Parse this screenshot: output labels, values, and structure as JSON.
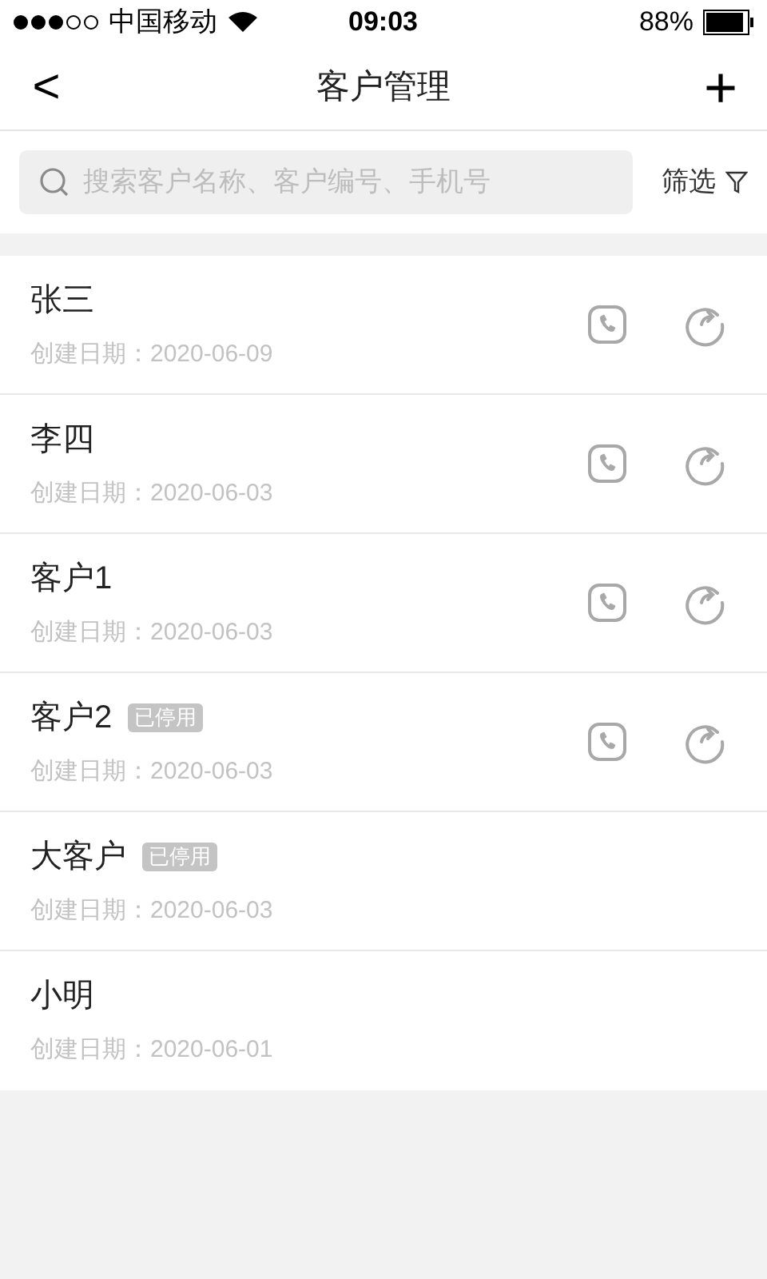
{
  "status_bar": {
    "carrier": "中国移动",
    "time": "09:03",
    "battery": "88%"
  },
  "nav": {
    "back": "<",
    "title": "客户管理",
    "add": "+"
  },
  "search": {
    "placeholder": "搜索客户名称、客户编号、手机号",
    "filter": "筛选"
  },
  "customers": [
    {
      "name": "张三",
      "date": "创建日期：2020-06-09",
      "actions": true
    },
    {
      "name": "李四",
      "date": "创建日期：2020-06-03",
      "actions": true
    },
    {
      "name": "客户1",
      "date": "创建日期：2020-06-03",
      "actions": true
    },
    {
      "name": "客户2",
      "badge": "已停用",
      "date": "创建日期：2020-06-03",
      "actions": true
    },
    {
      "name": "大客户",
      "badge": "已停用",
      "date": "创建日期：2020-06-03",
      "actions": false
    },
    {
      "name": "小明",
      "date": "创建日期：2020-06-01",
      "actions": false
    }
  ]
}
